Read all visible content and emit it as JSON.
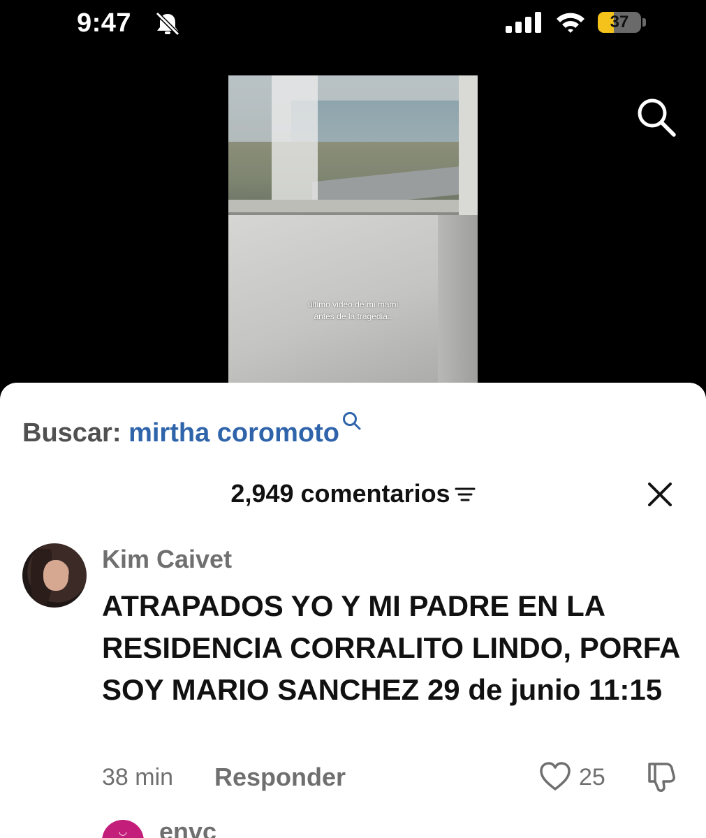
{
  "status_bar": {
    "time": "9:47",
    "battery_level": "37",
    "battery_fraction": 0.37,
    "icons": [
      "bell-muted-icon",
      "cellular-signal-icon",
      "wifi-icon",
      "battery-icon"
    ]
  },
  "video": {
    "caption_line1": "último video de mi mami",
    "caption_line2": "antes de la tragedia.."
  },
  "search_banner": {
    "prefix": "Buscar: ",
    "term": "mirtha coromoto"
  },
  "comments": {
    "header": "2,949 comentarios",
    "items": [
      {
        "author": "Kim Caivet",
        "text": "ATRAPADOS YO Y MI PADRE EN LA RESIDENCIA CORRALITO LINDO, PORFA SOY MARIO SANCHEZ 29 de junio 11:15",
        "time": "38 min",
        "reply_label": "Responder",
        "likes": "25"
      },
      {
        "author": "envc"
      }
    ]
  },
  "colors": {
    "search_term": "#2f64ab",
    "battery_fill": "#f4c21b",
    "muted_text": "#6f6f6f"
  }
}
